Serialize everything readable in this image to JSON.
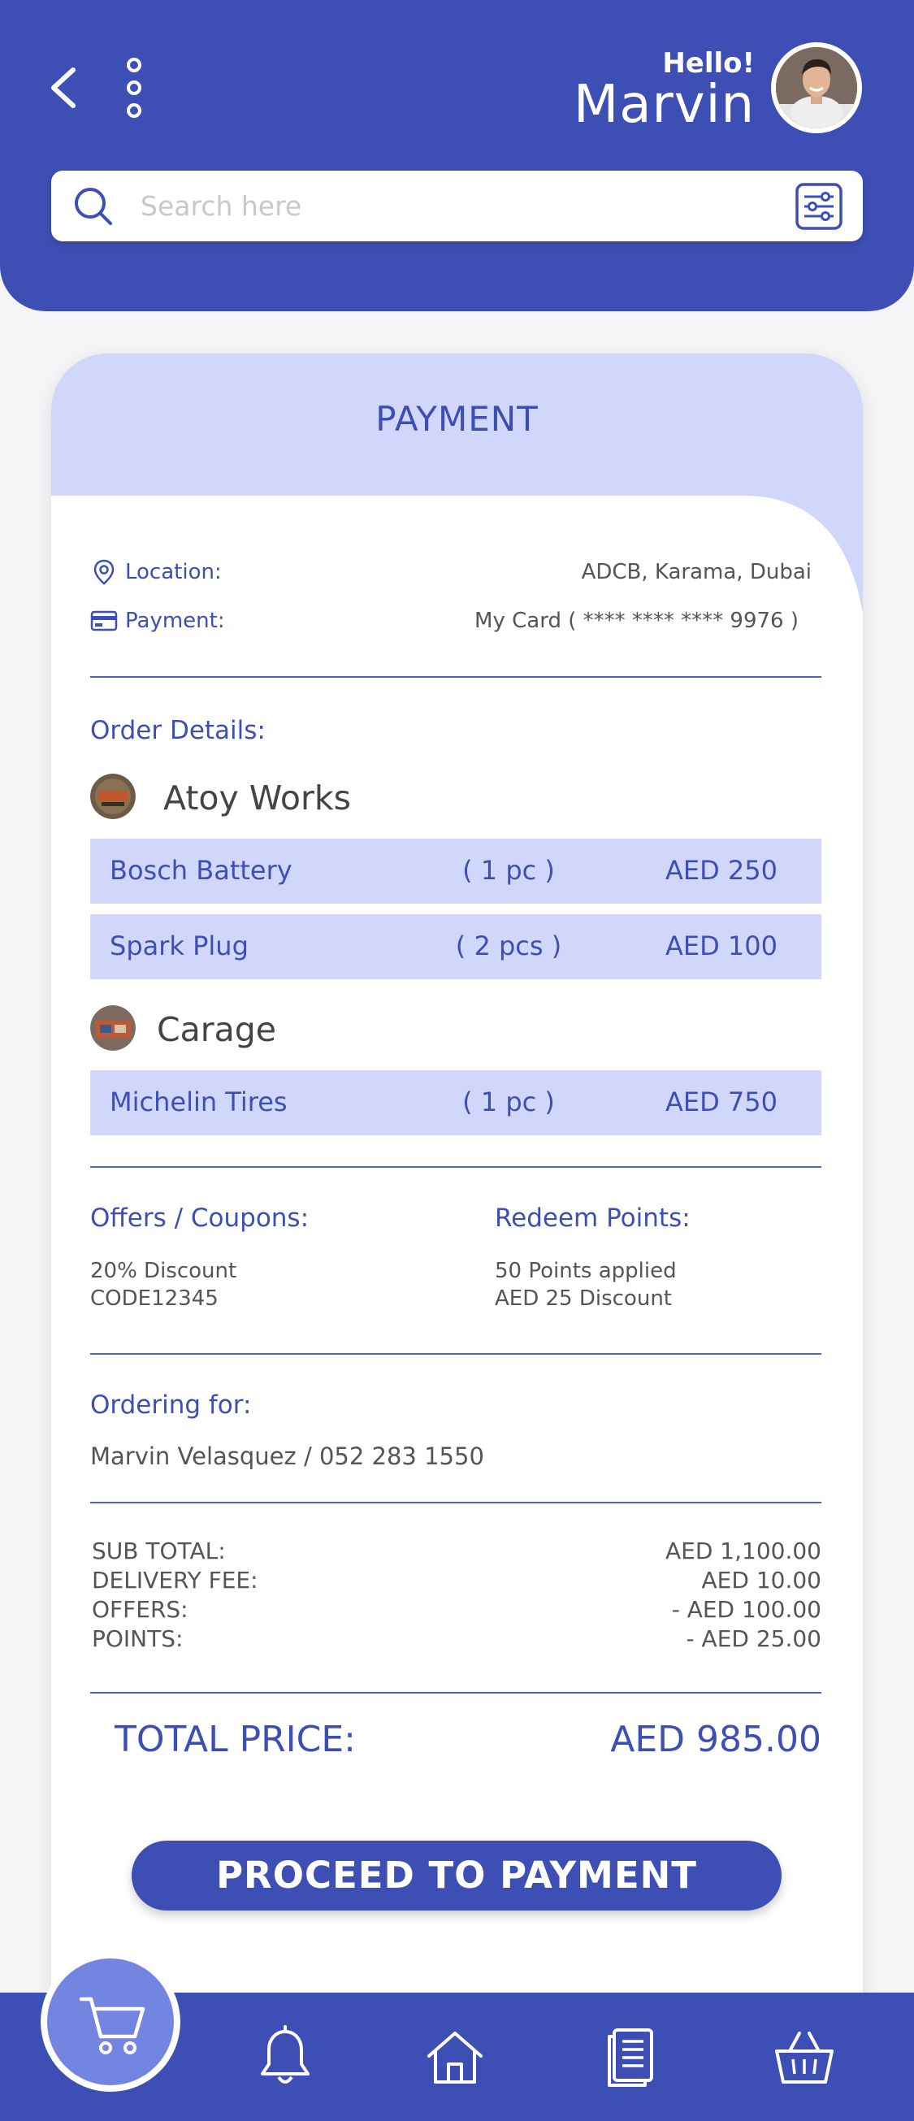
{
  "header": {
    "greeting": "Hello!",
    "username": "Marvin",
    "search_placeholder": "Search here",
    "brand_color": "#3d4fb5"
  },
  "icons": [
    "back-icon",
    "more-icon",
    "search-icon",
    "filter-icon",
    "location-icon",
    "card-icon",
    "cart-icon",
    "bell-icon",
    "home-icon",
    "orders-icon",
    "basket-icon"
  ],
  "payment": {
    "title": "PAYMENT",
    "location_label": "Location:",
    "location_value": "ADCB, Karama, Dubai",
    "payment_label": "Payment:",
    "payment_value": "My Card ( **** **** **** 9976 )",
    "order_details_label": "Order Details:",
    "shops": [
      {
        "name": "Atoy Works",
        "items": [
          {
            "name": "Bosch Battery",
            "qty": "( 1 pc )",
            "price": "AED 250"
          },
          {
            "name": "Spark Plug",
            "qty": "( 2 pcs )",
            "price": "AED 100"
          }
        ]
      },
      {
        "name": "Carage",
        "items": [
          {
            "name": "Michelin Tires",
            "qty": "( 1 pc )",
            "price": "AED 750"
          }
        ]
      }
    ],
    "offers_label": "Offers / Coupons:",
    "offers_line1": "20% Discount",
    "offers_line2": "CODE12345",
    "redeem_label": "Redeem Points:",
    "redeem_line1": "50 Points applied",
    "redeem_line2": "AED 25 Discount",
    "ordering_for_label": "Ordering for:",
    "ordering_for_value": "Marvin Velasquez / 052 283 1550",
    "totals": [
      {
        "label": "SUB TOTAL:",
        "value": "AED 1,100.00"
      },
      {
        "label": "DELIVERY FEE:",
        "value": "AED 10.00"
      },
      {
        "label": "OFFERS:",
        "value": "- AED 100.00"
      },
      {
        "label": "POINTS:",
        "value": "- AED 25.00"
      }
    ],
    "total_label": "TOTAL PRICE:",
    "total_value": "AED 985.00",
    "proceed_label": "PROCEED TO PAYMENT"
  }
}
